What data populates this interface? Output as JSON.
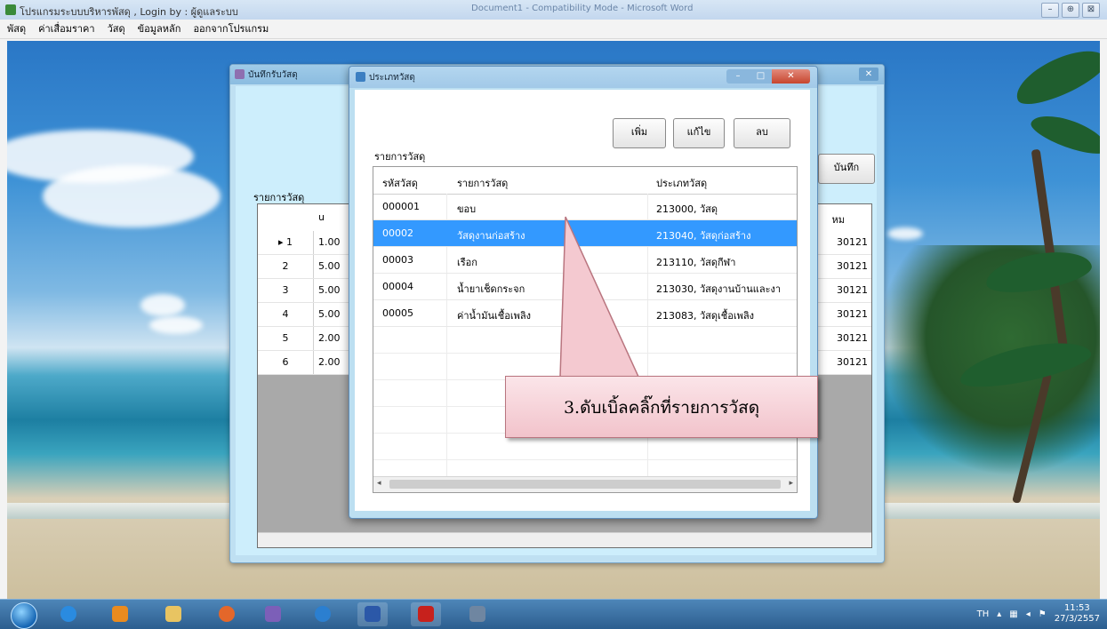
{
  "window": {
    "title": "โปรแกรมระบบบริหารพัสดุ , Login by : ผู้ดูแลระบบ",
    "title_middle": "Document1 - Compatibility Mode - Microsoft Word",
    "controls": [
      "–",
      "⊕",
      "⊠"
    ]
  },
  "menu": [
    "พัสดุ",
    "ค่าเสื่อมราคา",
    "วัสดุ",
    "ข้อมูลหลัก",
    "ออกจากโปรแกรม"
  ],
  "back_window": {
    "title": "บันทึกรับวัสดุ",
    "save_label": "บันทึก",
    "items_label": "รายการวัสดุ",
    "grid_headers": [
      "u",
      "หม"
    ],
    "rows": [
      {
        "idx": "1",
        "qty": "1.00",
        "code": "30121"
      },
      {
        "idx": "2",
        "qty": "5.00",
        "code": "30121"
      },
      {
        "idx": "3",
        "qty": "5.00",
        "code": "30121"
      },
      {
        "idx": "4",
        "qty": "5.00",
        "code": "30121"
      },
      {
        "idx": "5",
        "qty": "2.00",
        "code": "30121"
      },
      {
        "idx": "6",
        "qty": "2.00",
        "code": "30121"
      }
    ]
  },
  "dialog": {
    "title": "ประเภทวัสดุ",
    "buttons": {
      "add": "เพิ่ม",
      "edit": "แก้ไข",
      "delete": "ลบ"
    },
    "list_title": "รายการวัสดุ",
    "columns": [
      "รหัสวัสดุ",
      "รายการวัสดุ",
      "ประเภทวัสดุ"
    ],
    "rows": [
      {
        "code": "000001",
        "name": "ขอบ",
        "type": "213000, วัสดุ",
        "selected": false
      },
      {
        "code": "00002",
        "name": "วัสดุงานก่อสร้าง",
        "type": "213040, วัสดุก่อสร้าง",
        "selected": true
      },
      {
        "code": "00003",
        "name": "เรือก",
        "type": "213110, วัสดุกีฬา",
        "selected": false
      },
      {
        "code": "00004",
        "name": "น้ำยาเช็ดกระจก",
        "type": "213030, วัสดุงานบ้านและงา",
        "selected": false
      },
      {
        "code": "00005",
        "name": "ค่าน้ำมันเชื้อเพลิง",
        "type": "213083, วัสดุเชื้อเพลิง",
        "selected": false
      }
    ]
  },
  "callout": {
    "text": "3.ดับเบิ้ลคลิ๊กที่รายการวัสดุ",
    "fill": "#f4c9d0",
    "border": "#b9757f"
  },
  "taskbar": {
    "apps": [
      "ie-icon",
      "media-icon",
      "folder-icon",
      "firefox-icon",
      "chat-icon",
      "sync-icon",
      "word-icon",
      "acrobat-icon",
      "misc-icon"
    ],
    "tray": {
      "lang": "TH",
      "time": "11:53",
      "date": "27/3/2557"
    }
  }
}
